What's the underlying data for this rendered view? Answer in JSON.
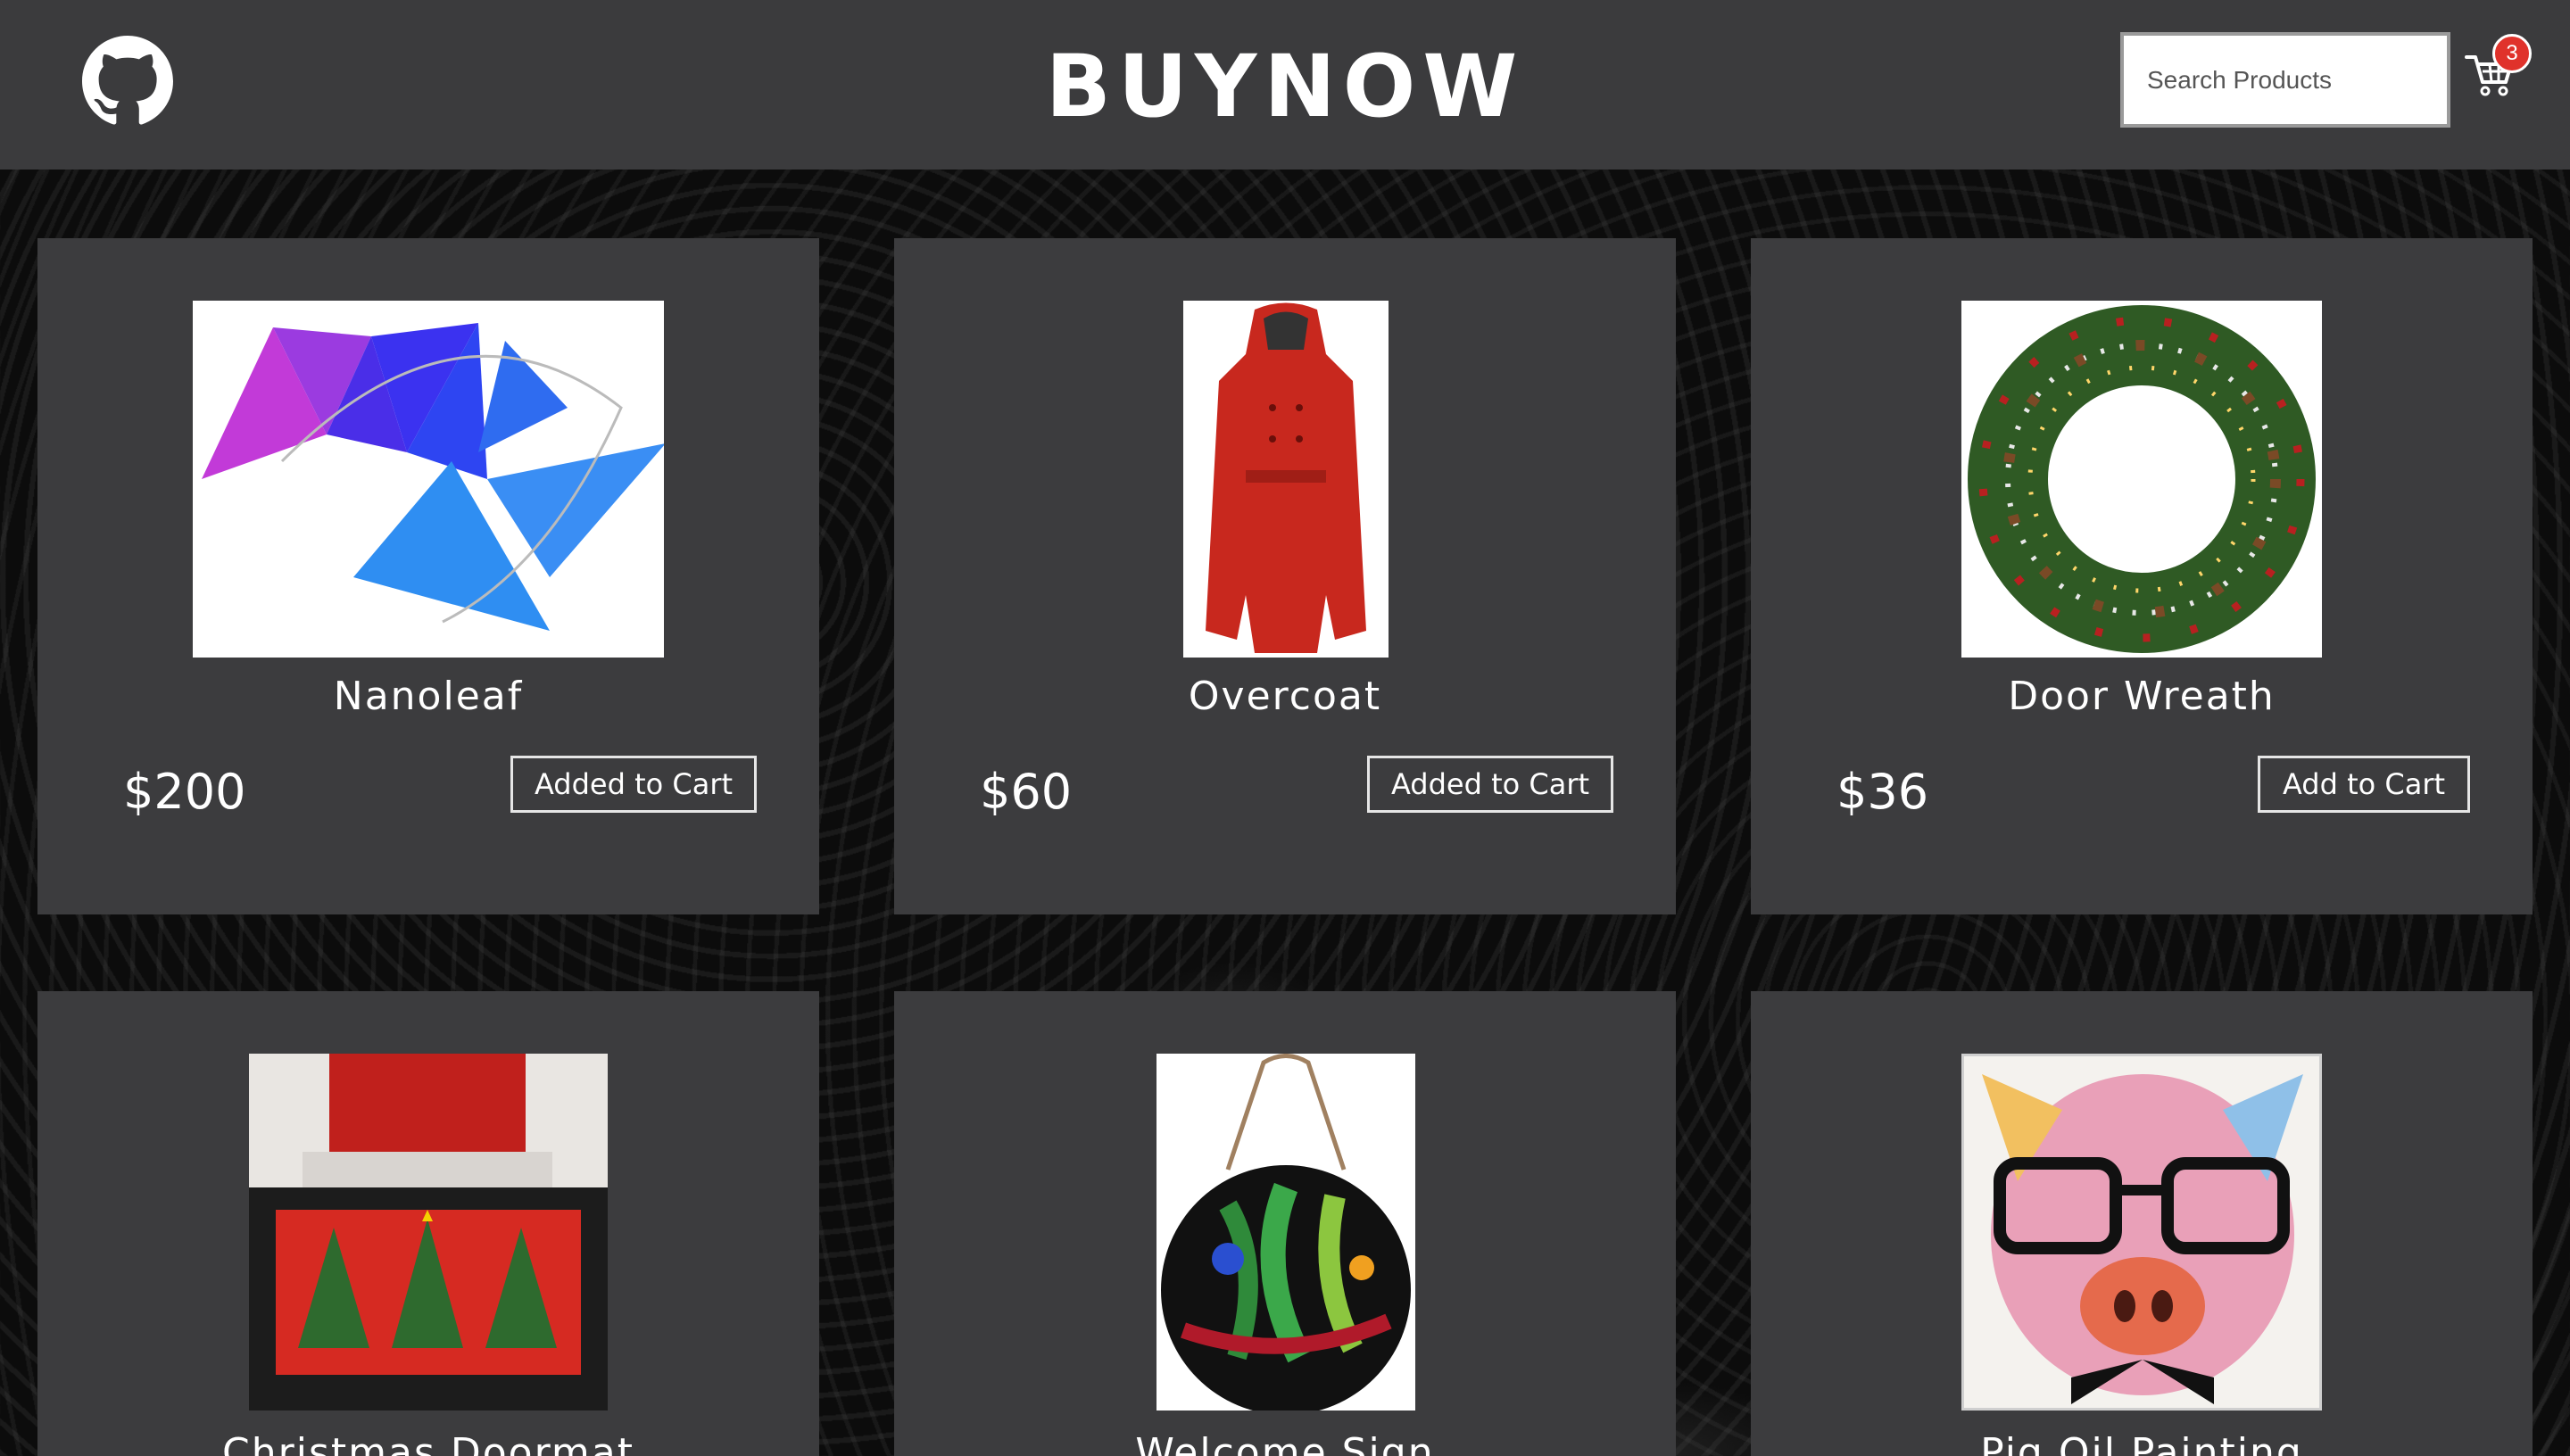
{
  "header": {
    "brand": "BUYNOW",
    "search_placeholder": "Search Products",
    "cart_count": "3"
  },
  "products": [
    {
      "name": "Nanoleaf",
      "price": "$200",
      "button": "Added to Cart",
      "image": "nanoleaf-panels-image"
    },
    {
      "name": "Overcoat",
      "price": "$60",
      "button": "Added to Cart",
      "image": "red-overcoat-image"
    },
    {
      "name": "Door Wreath",
      "price": "$36",
      "button": "Add to Cart",
      "image": "christmas-wreath-image"
    },
    {
      "name": "Christmas Doormat",
      "image": "christmas-doormat-image"
    },
    {
      "name": "Welcome Sign",
      "image": "welcome-sign-image"
    },
    {
      "name": "Pig Oil Painting",
      "image": "pig-painting-image"
    }
  ],
  "colors": {
    "header_bg": "#3b3b3d",
    "card_bg": "#3c3c3e",
    "badge": "#e0322b"
  }
}
